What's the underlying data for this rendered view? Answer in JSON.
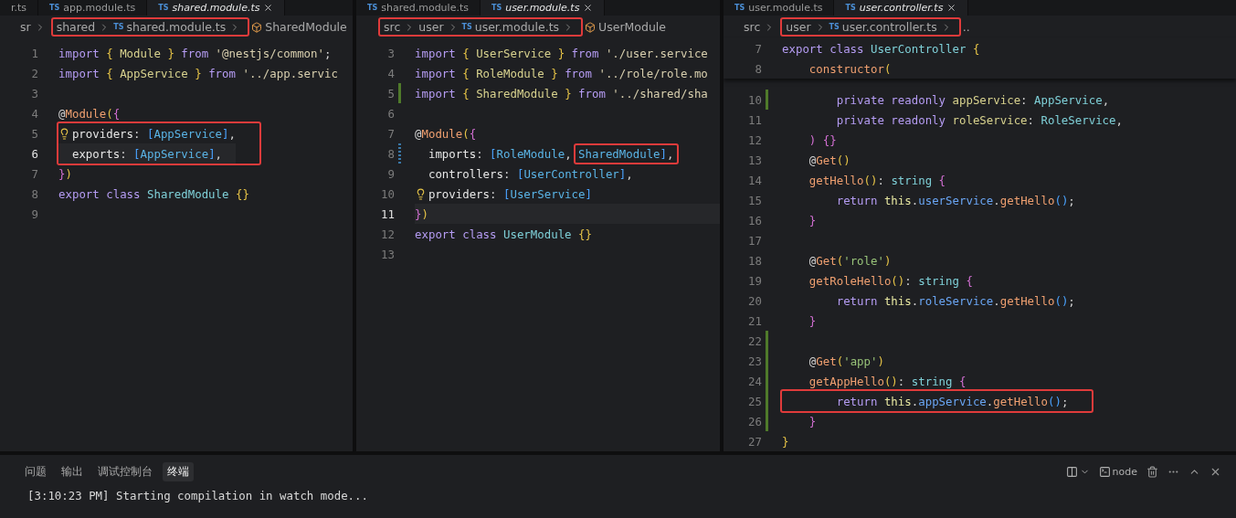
{
  "editors": [
    {
      "tabs": [
        {
          "label": "r.ts",
          "selected": false,
          "preview": false
        },
        {
          "label": "app.module.ts",
          "lang": "TS",
          "selected": false,
          "preview": false
        },
        {
          "label": "shared.module.ts",
          "lang": "TS",
          "selected": true,
          "preview": true
        }
      ],
      "breadcrumb": [
        {
          "text": "sr",
          "kind": "folder",
          "boxed": false
        },
        {
          "text": "shared",
          "kind": "folder",
          "boxed": true
        },
        {
          "text": "shared.module.ts",
          "kind": "file",
          "lang": "TS",
          "boxed": true
        },
        {
          "text": "SharedModule",
          "kind": "symbol",
          "boxed": false
        }
      ],
      "lines": [
        {
          "number": "1",
          "tokens": [
            {
              "text": "import ",
              "kind": "kw"
            },
            {
              "text": "{",
              "kind": "brace"
            },
            {
              "text": " Module ",
              "kind": "name"
            },
            {
              "text": "}",
              "kind": "brace"
            },
            {
              "text": " from ",
              "kind": "kw"
            },
            {
              "text": "'@nestjs/common'",
              "kind": "path"
            },
            {
              "text": ";",
              "kind": "punct"
            }
          ]
        },
        {
          "number": "2",
          "tokens": [
            {
              "text": "import ",
              "kind": "kw"
            },
            {
              "text": "{",
              "kind": "brace"
            },
            {
              "text": " AppService ",
              "kind": "name"
            },
            {
              "text": "}",
              "kind": "brace"
            },
            {
              "text": " from ",
              "kind": "kw"
            },
            {
              "text": "'../app.servic",
              "kind": "path"
            }
          ]
        },
        {
          "number": "3"
        },
        {
          "number": "4",
          "tokens": [
            {
              "text": "@",
              "kind": "punct"
            },
            {
              "text": "Module",
              "kind": "deco"
            },
            {
              "text": "(",
              "kind": "brace"
            },
            {
              "text": "{",
              "kind": "pink"
            }
          ]
        },
        {
          "number": "5",
          "bulb": true,
          "boxed": true,
          "tokens": [
            {
              "text": "providers",
              "kind": "prop"
            },
            {
              "text": ": ",
              "kind": "punct"
            },
            {
              "text": "[",
              "kind": "bracket"
            },
            {
              "text": "AppService",
              "kind": "type"
            },
            {
              "text": "]",
              "kind": "bracket"
            },
            {
              "text": ",",
              "kind": "punct"
            }
          ]
        },
        {
          "number": "6",
          "current": true,
          "boxed": true,
          "tokens": [
            {
              "text": "  exports",
              "kind": "prop"
            },
            {
              "text": ": ",
              "kind": "punct"
            },
            {
              "text": "[",
              "kind": "bracket"
            },
            {
              "text": "AppService",
              "kind": "type"
            },
            {
              "text": "]",
              "kind": "bracket"
            },
            {
              "text": ",",
              "kind": "punct"
            }
          ]
        },
        {
          "number": "7",
          "tokens": [
            {
              "text": "}",
              "kind": "pink"
            },
            {
              "text": ")",
              "kind": "brace"
            }
          ]
        },
        {
          "number": "8",
          "tokens": [
            {
              "text": "export class ",
              "kind": "kw"
            },
            {
              "text": "SharedModule ",
              "kind": "cls"
            },
            {
              "text": "{}",
              "kind": "brace"
            }
          ]
        },
        {
          "number": "9"
        }
      ]
    },
    {
      "tabs": [
        {
          "label": "shared.module.ts",
          "lang": "TS",
          "selected": false,
          "preview": false
        },
        {
          "label": "user.module.ts",
          "lang": "TS",
          "selected": true,
          "preview": true
        }
      ],
      "breadcrumb": [
        {
          "text": "src",
          "kind": "folder",
          "boxed": true
        },
        {
          "text": "user",
          "kind": "folder",
          "boxed": true
        },
        {
          "text": "user.module.ts",
          "kind": "file",
          "lang": "TS",
          "boxed": true
        },
        {
          "text": "UserModule",
          "kind": "symbol",
          "boxed": false
        }
      ],
      "lines": [
        {
          "number": "3",
          "tokens": [
            {
              "text": "import ",
              "kind": "kw"
            },
            {
              "text": "{",
              "kind": "brace"
            },
            {
              "text": " UserService ",
              "kind": "name"
            },
            {
              "text": "}",
              "kind": "brace"
            },
            {
              "text": " from ",
              "kind": "kw"
            },
            {
              "text": "'./user.service",
              "kind": "path"
            }
          ]
        },
        {
          "number": "4",
          "tokens": [
            {
              "text": "import ",
              "kind": "kw"
            },
            {
              "text": "{",
              "kind": "brace"
            },
            {
              "text": " RoleModule ",
              "kind": "name"
            },
            {
              "text": "}",
              "kind": "brace"
            },
            {
              "text": " from ",
              "kind": "kw"
            },
            {
              "text": "'../role/role.mo",
              "kind": "path"
            }
          ]
        },
        {
          "number": "5",
          "added": true,
          "tokens": [
            {
              "text": "import ",
              "kind": "kw"
            },
            {
              "text": "{",
              "kind": "brace"
            },
            {
              "text": " SharedModule ",
              "kind": "name"
            },
            {
              "text": "}",
              "kind": "brace"
            },
            {
              "text": " from ",
              "kind": "kw"
            },
            {
              "text": "'../shared/sha",
              "kind": "path"
            }
          ]
        },
        {
          "number": "6"
        },
        {
          "number": "7",
          "tokens": [
            {
              "text": "@",
              "kind": "punct"
            },
            {
              "text": "Module",
              "kind": "deco"
            },
            {
              "text": "(",
              "kind": "brace"
            },
            {
              "text": "{",
              "kind": "pink"
            }
          ]
        },
        {
          "number": "8",
          "modified": true,
          "tokens": [
            {
              "text": "  imports",
              "kind": "prop"
            },
            {
              "text": ": ",
              "kind": "punct"
            },
            {
              "text": "[",
              "kind": "bracket"
            },
            {
              "text": "RoleModule",
              "kind": "type"
            },
            {
              "text": ", ",
              "kind": "punct"
            },
            {
              "text": "SharedModule",
              "kind": "type",
              "boxed": true
            },
            {
              "text": "]",
              "kind": "bracket",
              "boxed": true
            },
            {
              "text": ",",
              "kind": "punct",
              "boxed": true
            }
          ]
        },
        {
          "number": "9",
          "tokens": [
            {
              "text": "  controllers",
              "kind": "prop"
            },
            {
              "text": ": ",
              "kind": "punct"
            },
            {
              "text": "[",
              "kind": "bracket"
            },
            {
              "text": "UserController",
              "kind": "type"
            },
            {
              "text": "]",
              "kind": "bracket"
            },
            {
              "text": ",",
              "kind": "punct"
            }
          ]
        },
        {
          "number": "10",
          "bulb": true,
          "tokens": [
            {
              "text": "providers",
              "kind": "prop"
            },
            {
              "text": ": ",
              "kind": "punct"
            },
            {
              "text": "[",
              "kind": "bracket"
            },
            {
              "text": "UserService",
              "kind": "type"
            },
            {
              "text": "]",
              "kind": "bracket"
            }
          ]
        },
        {
          "number": "11",
          "current": true,
          "tokens": [
            {
              "text": "}",
              "kind": "pink"
            },
            {
              "text": ")",
              "kind": "brace"
            }
          ]
        },
        {
          "number": "12",
          "tokens": [
            {
              "text": "export class ",
              "kind": "kw"
            },
            {
              "text": "UserModule ",
              "kind": "cls"
            },
            {
              "text": "{}",
              "kind": "brace"
            }
          ]
        },
        {
          "number": "13"
        }
      ]
    },
    {
      "tabs": [
        {
          "label": "user.module.ts",
          "lang": "TS",
          "selected": false,
          "preview": false
        },
        {
          "label": "user.controller.ts",
          "lang": "TS",
          "selected": true,
          "preview": true
        }
      ],
      "breadcrumb": [
        {
          "text": "src",
          "kind": "folder",
          "boxed": false
        },
        {
          "text": "user",
          "kind": "folder",
          "boxed": true
        },
        {
          "text": "user.controller.ts",
          "kind": "file",
          "lang": "TS",
          "boxed": true
        },
        {
          "text": "..",
          "kind": "more",
          "boxed": false
        }
      ],
      "lines": [
        {
          "number": "7",
          "sticky": true,
          "tokens": [
            {
              "text": "export class ",
              "kind": "kw"
            },
            {
              "text": "UserController ",
              "kind": "cls"
            },
            {
              "text": "{",
              "kind": "brace"
            }
          ]
        },
        {
          "number": "8",
          "sticky": true,
          "tokens": [
            {
              "text": "    constructor",
              "kind": "fn"
            },
            {
              "text": "(",
              "kind": "brace"
            }
          ]
        },
        {
          "number": "10",
          "added": true,
          "tokens": [
            {
              "text": "        private readonly ",
              "kind": "kw"
            },
            {
              "text": "appService",
              "kind": "name"
            },
            {
              "text": ": ",
              "kind": "punct"
            },
            {
              "text": "AppService",
              "kind": "cls"
            },
            {
              "text": ",",
              "kind": "punct"
            }
          ]
        },
        {
          "number": "11",
          "tokens": [
            {
              "text": "        private readonly ",
              "kind": "kw"
            },
            {
              "text": "roleService",
              "kind": "name"
            },
            {
              "text": ": ",
              "kind": "punct"
            },
            {
              "text": "RoleService",
              "kind": "cls"
            },
            {
              "text": ",",
              "kind": "punct"
            }
          ]
        },
        {
          "number": "12",
          "tokens": [
            {
              "text": "    )",
              "kind": "pink"
            },
            {
              "text": " {}",
              "kind": "pink"
            }
          ]
        },
        {
          "number": "13",
          "tokens": [
            {
              "text": "    @",
              "kind": "punct"
            },
            {
              "text": "Get",
              "kind": "deco"
            },
            {
              "text": "()",
              "kind": "brace"
            }
          ]
        },
        {
          "number": "14",
          "tokens": [
            {
              "text": "    getHello",
              "kind": "fn"
            },
            {
              "text": "()",
              "kind": "brace"
            },
            {
              "text": ": ",
              "kind": "punct"
            },
            {
              "text": "string ",
              "kind": "cls"
            },
            {
              "text": "{",
              "kind": "pink"
            }
          ]
        },
        {
          "number": "15",
          "tokens": [
            {
              "text": "        return ",
              "kind": "kw"
            },
            {
              "text": "this",
              "kind": "this"
            },
            {
              "text": ".",
              "kind": "punct"
            },
            {
              "text": "userService",
              "kind": "member"
            },
            {
              "text": ".",
              "kind": "punct"
            },
            {
              "text": "getHello",
              "kind": "fn"
            },
            {
              "text": "()",
              "kind": "bracket"
            },
            {
              "text": ";",
              "kind": "punct"
            }
          ]
        },
        {
          "number": "16",
          "tokens": [
            {
              "text": "    }",
              "kind": "pink"
            }
          ]
        },
        {
          "number": "17"
        },
        {
          "number": "18",
          "tokens": [
            {
              "text": "    @",
              "kind": "punct"
            },
            {
              "text": "Get",
              "kind": "deco"
            },
            {
              "text": "(",
              "kind": "brace"
            },
            {
              "text": "'role'",
              "kind": "str"
            },
            {
              "text": ")",
              "kind": "brace"
            }
          ]
        },
        {
          "number": "19",
          "tokens": [
            {
              "text": "    getRoleHello",
              "kind": "fn"
            },
            {
              "text": "()",
              "kind": "brace"
            },
            {
              "text": ": ",
              "kind": "punct"
            },
            {
              "text": "string ",
              "kind": "cls"
            },
            {
              "text": "{",
              "kind": "pink"
            }
          ]
        },
        {
          "number": "20",
          "tokens": [
            {
              "text": "        return ",
              "kind": "kw"
            },
            {
              "text": "this",
              "kind": "this"
            },
            {
              "text": ".",
              "kind": "punct"
            },
            {
              "text": "roleService",
              "kind": "member"
            },
            {
              "text": ".",
              "kind": "punct"
            },
            {
              "text": "getHello",
              "kind": "fn"
            },
            {
              "text": "()",
              "kind": "bracket"
            },
            {
              "text": ";",
              "kind": "punct"
            }
          ]
        },
        {
          "number": "21",
          "tokens": [
            {
              "text": "    }",
              "kind": "pink"
            }
          ]
        },
        {
          "number": "22",
          "added": true
        },
        {
          "number": "23",
          "added": true,
          "tokens": [
            {
              "text": "    @",
              "kind": "punct"
            },
            {
              "text": "Get",
              "kind": "deco"
            },
            {
              "text": "(",
              "kind": "brace"
            },
            {
              "text": "'app'",
              "kind": "str"
            },
            {
              "text": ")",
              "kind": "brace"
            }
          ]
        },
        {
          "number": "24",
          "added": true,
          "tokens": [
            {
              "text": "    getAppHello",
              "kind": "fn"
            },
            {
              "text": "()",
              "kind": "brace"
            },
            {
              "text": ": ",
              "kind": "punct"
            },
            {
              "text": "string ",
              "kind": "cls"
            },
            {
              "text": "{",
              "kind": "pink"
            }
          ]
        },
        {
          "number": "25",
          "added": true,
          "boxed": true,
          "tokens": [
            {
              "text": "        return ",
              "kind": "kw"
            },
            {
              "text": "this",
              "kind": "this"
            },
            {
              "text": ".",
              "kind": "punct"
            },
            {
              "text": "appService",
              "kind": "member"
            },
            {
              "text": ".",
              "kind": "punct"
            },
            {
              "text": "getHello",
              "kind": "fn"
            },
            {
              "text": "()",
              "kind": "bracket"
            },
            {
              "text": ";",
              "kind": "punct"
            }
          ]
        },
        {
          "number": "26",
          "added": true,
          "tokens": [
            {
              "text": "    }",
              "kind": "pink"
            }
          ]
        },
        {
          "number": "27",
          "tokens": [
            {
              "text": "}",
              "kind": "brace"
            }
          ]
        }
      ]
    }
  ],
  "panel": {
    "tabs": [
      {
        "label": "问题",
        "selected": false
      },
      {
        "label": "输出",
        "selected": false
      },
      {
        "label": "调试控制台",
        "selected": false
      },
      {
        "label": "终端",
        "selected": true
      }
    ],
    "terminal_name": "node",
    "terminal_line": "[3:10:23 PM] Starting compilation in watch mode..."
  }
}
